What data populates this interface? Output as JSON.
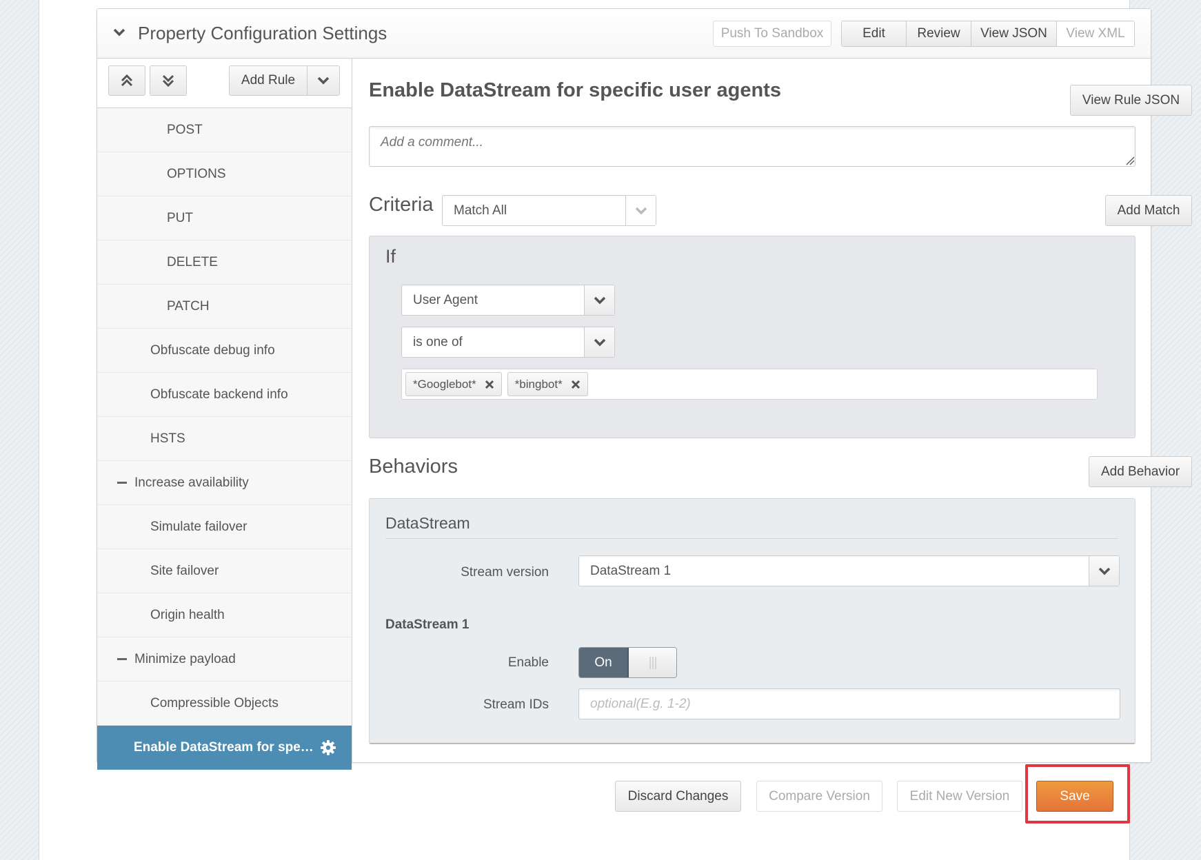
{
  "panel": {
    "title": "Property Configuration Settings",
    "push_to_sandbox": "Push To Sandbox",
    "view_tabs": [
      {
        "label": "Edit",
        "disabled": false
      },
      {
        "label": "Review",
        "disabled": false
      },
      {
        "label": "View JSON",
        "disabled": false
      },
      {
        "label": "View XML",
        "disabled": true
      }
    ]
  },
  "tree": {
    "toolbar": {
      "move_up_icon": "double-chevron-up",
      "move_down_icon": "double-chevron-down",
      "add_rule": "Add Rule"
    },
    "items": [
      {
        "label": "POST",
        "level": 3
      },
      {
        "label": "OPTIONS",
        "level": 3
      },
      {
        "label": "PUT",
        "level": 3
      },
      {
        "label": "DELETE",
        "level": 3
      },
      {
        "label": "PATCH",
        "level": 3
      },
      {
        "label": "Obfuscate debug info",
        "level": 2
      },
      {
        "label": "Obfuscate backend info",
        "level": 2
      },
      {
        "label": "HSTS",
        "level": 2
      },
      {
        "label": "Increase availability",
        "level": 1,
        "collapsible": true
      },
      {
        "label": "Simulate failover",
        "level": 2
      },
      {
        "label": "Site failover",
        "level": 2
      },
      {
        "label": "Origin health",
        "level": 2
      },
      {
        "label": "Minimize payload",
        "level": 1,
        "collapsible": true
      },
      {
        "label": "Compressible Objects",
        "level": 2
      }
    ],
    "selected": {
      "label": "Enable DataStream for spe…",
      "icon": "gear-icon"
    }
  },
  "rule": {
    "title": "Enable DataStream for specific user agents",
    "view_rule_json": "View Rule JSON",
    "comment_placeholder": "Add a comment...",
    "criteria": {
      "label": "Criteria",
      "match_mode": "Match All",
      "add_match": "Add Match",
      "if_label": "If",
      "field": "User Agent",
      "operator": "is one of",
      "values": [
        "*Googlebot*",
        "*bingbot*"
      ]
    },
    "behaviors": {
      "label": "Behaviors",
      "add_behavior": "Add Behavior",
      "items": [
        {
          "name": "DataStream",
          "stream_version_label": "Stream version",
          "stream_version_value": "DataStream 1",
          "subheading": "DataStream 1",
          "enable_label": "Enable",
          "enable_value": "On",
          "stream_ids_label": "Stream IDs",
          "stream_ids_placeholder": "optional(E.g. 1-2)"
        }
      ]
    }
  },
  "footer": {
    "discard": "Discard Changes",
    "compare": "Compare Version",
    "edit_new": "Edit New Version",
    "save": "Save"
  },
  "colors": {
    "selected_rule": "#4d8db3",
    "save_button": "#e97f3b",
    "highlight_box": "#e0363f",
    "toggle_on": "#5c6b7a"
  }
}
